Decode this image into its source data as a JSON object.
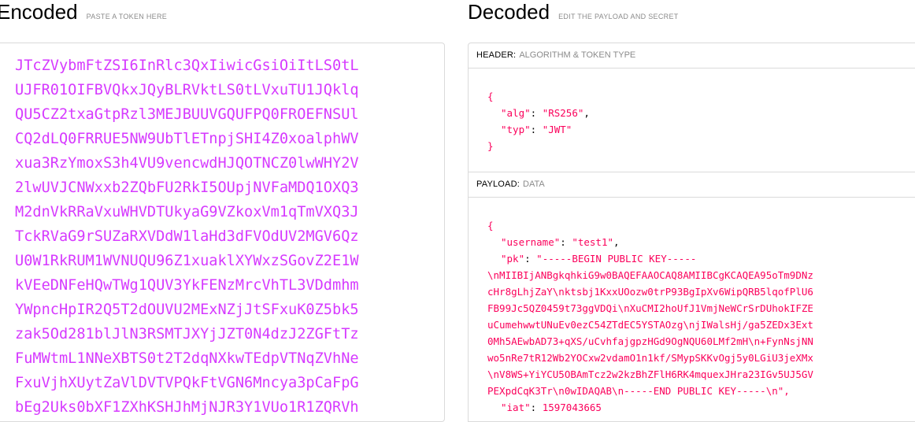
{
  "encoded": {
    "title": "Encoded",
    "subtitle": "PASTE A TOKEN HERE",
    "lines": [
      "JTcZVybmFtZSI6InRlc3QxIiwicGsiOiItLS0tL",
      "UJFR01OIFBVQkxJQyBLRVktLS0tLVxuTU1JQklq",
      "QU5CZ2txaGtpRzl3MEJBUUVGQUFPQ0FROEFNSUl",
      "CQ2dLQ0FRRUE5NW9UbTlETnpjSHI4Z0xoalphWV",
      "xua3RzYmoxS3h4VU9vencwdHJQOTNCZ0lwWHY2V",
      "2lwUVJCNWxxb2ZQbFU2RkI5OUpjNVFaMDQ1OXQ3",
      "M2dnVkRRaVxuWHVDTUkyaG9VZkoxVm1qTmVXQ3J",
      "TckRVaG9rSUZaRXVDdW1laHd3dFVOdUV2MGV6Qz",
      "U0W1RkRUM1WVNUQU96Z1xuaklXYWxzSGovZ2E1W",
      "kVEeDNFeHQwTWg1QUV3YkFENzMrcVhTL3VDdmhm",
      "YWpncHpIR2Q5T2dOUVU2MExNZjJtSFxuK0Z5bk5",
      "zak5Od281blJlN3RSMTJXYjJZT0N4dzJ2ZGFtTz",
      "FuMWtmL1NNeXBTS0t2T2dqNXkwTEdpVTNqZVhNe",
      "FxuVjhXUytZaVlDVTVPQkFtVGN6Mncya3pCaFpG",
      "bEg2Uks0bXF1ZXhKSHJhMjNJR3Y1VUo1R1ZQRVh"
    ]
  },
  "decoded": {
    "title": "Decoded",
    "subtitle": "EDIT THE PAYLOAD AND SECRET",
    "header_section": {
      "name": "HEADER:",
      "desc": "ALGORITHM & TOKEN TYPE"
    },
    "header_json": {
      "open": "{",
      "alg_key": "\"alg\"",
      "alg_val": "\"RS256\"",
      "typ_key": "\"typ\"",
      "typ_val": "\"JWT\"",
      "close": "}"
    },
    "payload_section": {
      "name": "PAYLOAD:",
      "desc": "DATA"
    },
    "payload_json": {
      "open": "{",
      "username_key": "\"username\"",
      "username_val": "\"test1\"",
      "pk_key": "\"pk\"",
      "pk_first": "\"-----BEGIN PUBLIC KEY-----",
      "pk_lines": [
        "\\nMIIBIjANBgkqhkiG9w0BAQEFAAOCAQ8AMIIBCgKCAQEA95oTm9DNz",
        "cHr8gLhjZaY\\nktsbj1KxxUOozw0trP93BgIpXv6WipQRB5lqofPlU6",
        "FB99Jc5QZ0459t73ggVDQi\\nXuCMI2hoUfJ1VmjNeWCrSrDUhokIFZE",
        "uCumehwwtUNuEv0ezC54ZTdEC5YSTAOzg\\njIWalsHj/ga5ZEDx3Ext",
        "0Mh5AEwbAD73+qXS/uCvhfajgpzHGd9OgNQU60LMf2mH\\n+FynNsjNN",
        "wo5nRe7tR12Wb2YOCxw2vdamO1n1kf/SMypSKKvOgj5y0LGiU3jeXMx",
        "\\nV8WS+YiYCU5OBAmTcz2w2kzBhZFlH6RK4mquexJHra23IGv5UJ5GV",
        "PEXpdCqK3Tr\\n0wIDAQAB\\n-----END PUBLIC KEY-----\\n\","
      ],
      "iat_key": "\"iat\"",
      "iat_val": "1597043665"
    }
  }
}
